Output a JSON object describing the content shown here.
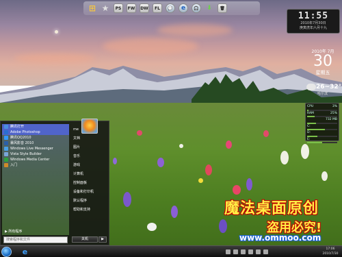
{
  "dock": {
    "items": [
      {
        "icon": "windows-logo-icon",
        "label": "⊞"
      },
      {
        "icon": "star-icon",
        "label": "★"
      },
      {
        "icon": "photoshop-icon",
        "label": "PS"
      },
      {
        "icon": "fireworks-icon",
        "label": "FW"
      },
      {
        "icon": "dreamweaver-icon",
        "label": "DW"
      },
      {
        "icon": "flash-icon",
        "label": "FL"
      },
      {
        "icon": "chat-icon",
        "label": "💬"
      },
      {
        "icon": "ie-icon",
        "label": "e"
      },
      {
        "icon": "headphones-icon",
        "label": "🎧"
      },
      {
        "icon": "arrow-down-icon",
        "label": "⬇"
      },
      {
        "icon": "recycle-bin-icon",
        "label": "🗑"
      }
    ]
  },
  "clock_widget": {
    "time": "11:55",
    "date_line": "2010年7月30日",
    "lunar_line": "庚寅虎年六月十九"
  },
  "date_widget": {
    "month": "2010年 7月",
    "day": "30",
    "weekday": "星期五"
  },
  "weather": {
    "temp": "26~32°",
    "city": "哈尔滨"
  },
  "monitor": {
    "rows": [
      {
        "label": "CPU",
        "value": "3%",
        "fill": 0.05
      },
      {
        "label": "RAM",
        "value": "25%",
        "fill": 0.25
      },
      {
        "label": "",
        "value": "732 MB",
        "fill": 0.3
      },
      {
        "label": "C:",
        "value": "",
        "fill": 0.6
      },
      {
        "label": "D:",
        "value": "",
        "fill": 0.35
      },
      {
        "label": "E:",
        "value": "",
        "fill": 0.5
      }
    ]
  },
  "start_menu": {
    "programs": [
      {
        "label": "腾讯打开",
        "color": "#4a8ee0",
        "highlight": true
      },
      {
        "label": "Adobe Photoshop",
        "color": "#2a6fd1",
        "highlight": true
      },
      {
        "label": "腾讯QQ2010",
        "color": "#3399ff",
        "highlight": false
      },
      {
        "label": "暴风影音 2010",
        "color": "#2b60a8",
        "highlight": false
      },
      {
        "label": "Windows Live Messenger",
        "color": "#49a0e8",
        "highlight": false
      },
      {
        "label": "Vista Style Builder",
        "color": "#7aa6d8",
        "highlight": false
      },
      {
        "label": "Windows Media Center",
        "color": "#2e9f3e",
        "highlight": false
      },
      {
        "label": "入门",
        "color": "#d08a2a",
        "highlight": false
      }
    ],
    "all_programs": "▶ 所有程序",
    "search_placeholder": "搜索程序和文件",
    "right_items": [
      "me",
      "文档",
      "图片",
      "音乐",
      "游戏",
      "计算机",
      "控制面板",
      "设备和打印机",
      "默认程序",
      "帮助和支持"
    ],
    "shutdown": "关机",
    "shutdown_arrow": "▶"
  },
  "watermark": {
    "title": "魔法桌面原创",
    "subtitle": "盗用必究!",
    "url": "www.ommoo.com"
  },
  "taskbar": {
    "ie_label": "e",
    "time": "17:06",
    "date": "2010/7/30"
  }
}
